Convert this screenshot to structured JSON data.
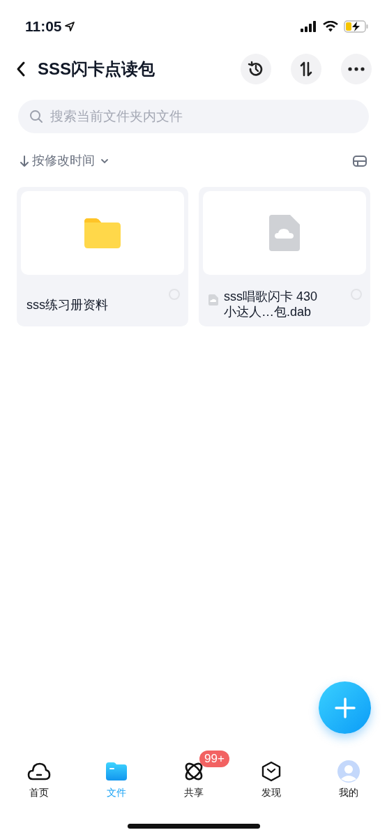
{
  "status_bar": {
    "time": "11:05"
  },
  "header": {
    "title": "SSS闪卡点读包"
  },
  "search": {
    "placeholder": "搜索当前文件夹内文件"
  },
  "sort": {
    "label": "按修改时间"
  },
  "items": [
    {
      "kind": "folder",
      "name": "sss练习册资料",
      "checked": false
    },
    {
      "kind": "file",
      "name": "sss唱歌闪卡 430\n小达人…包.dab",
      "checked": false
    }
  ],
  "tabs": [
    {
      "kind": "home",
      "label": "首页",
      "selected": false
    },
    {
      "kind": "files",
      "label": "文件",
      "selected": true
    },
    {
      "kind": "share",
      "label": "共享",
      "selected": false,
      "badge": "99+"
    },
    {
      "kind": "discover",
      "label": "发现",
      "selected": false
    },
    {
      "kind": "me",
      "label": "我的",
      "selected": false
    }
  ]
}
